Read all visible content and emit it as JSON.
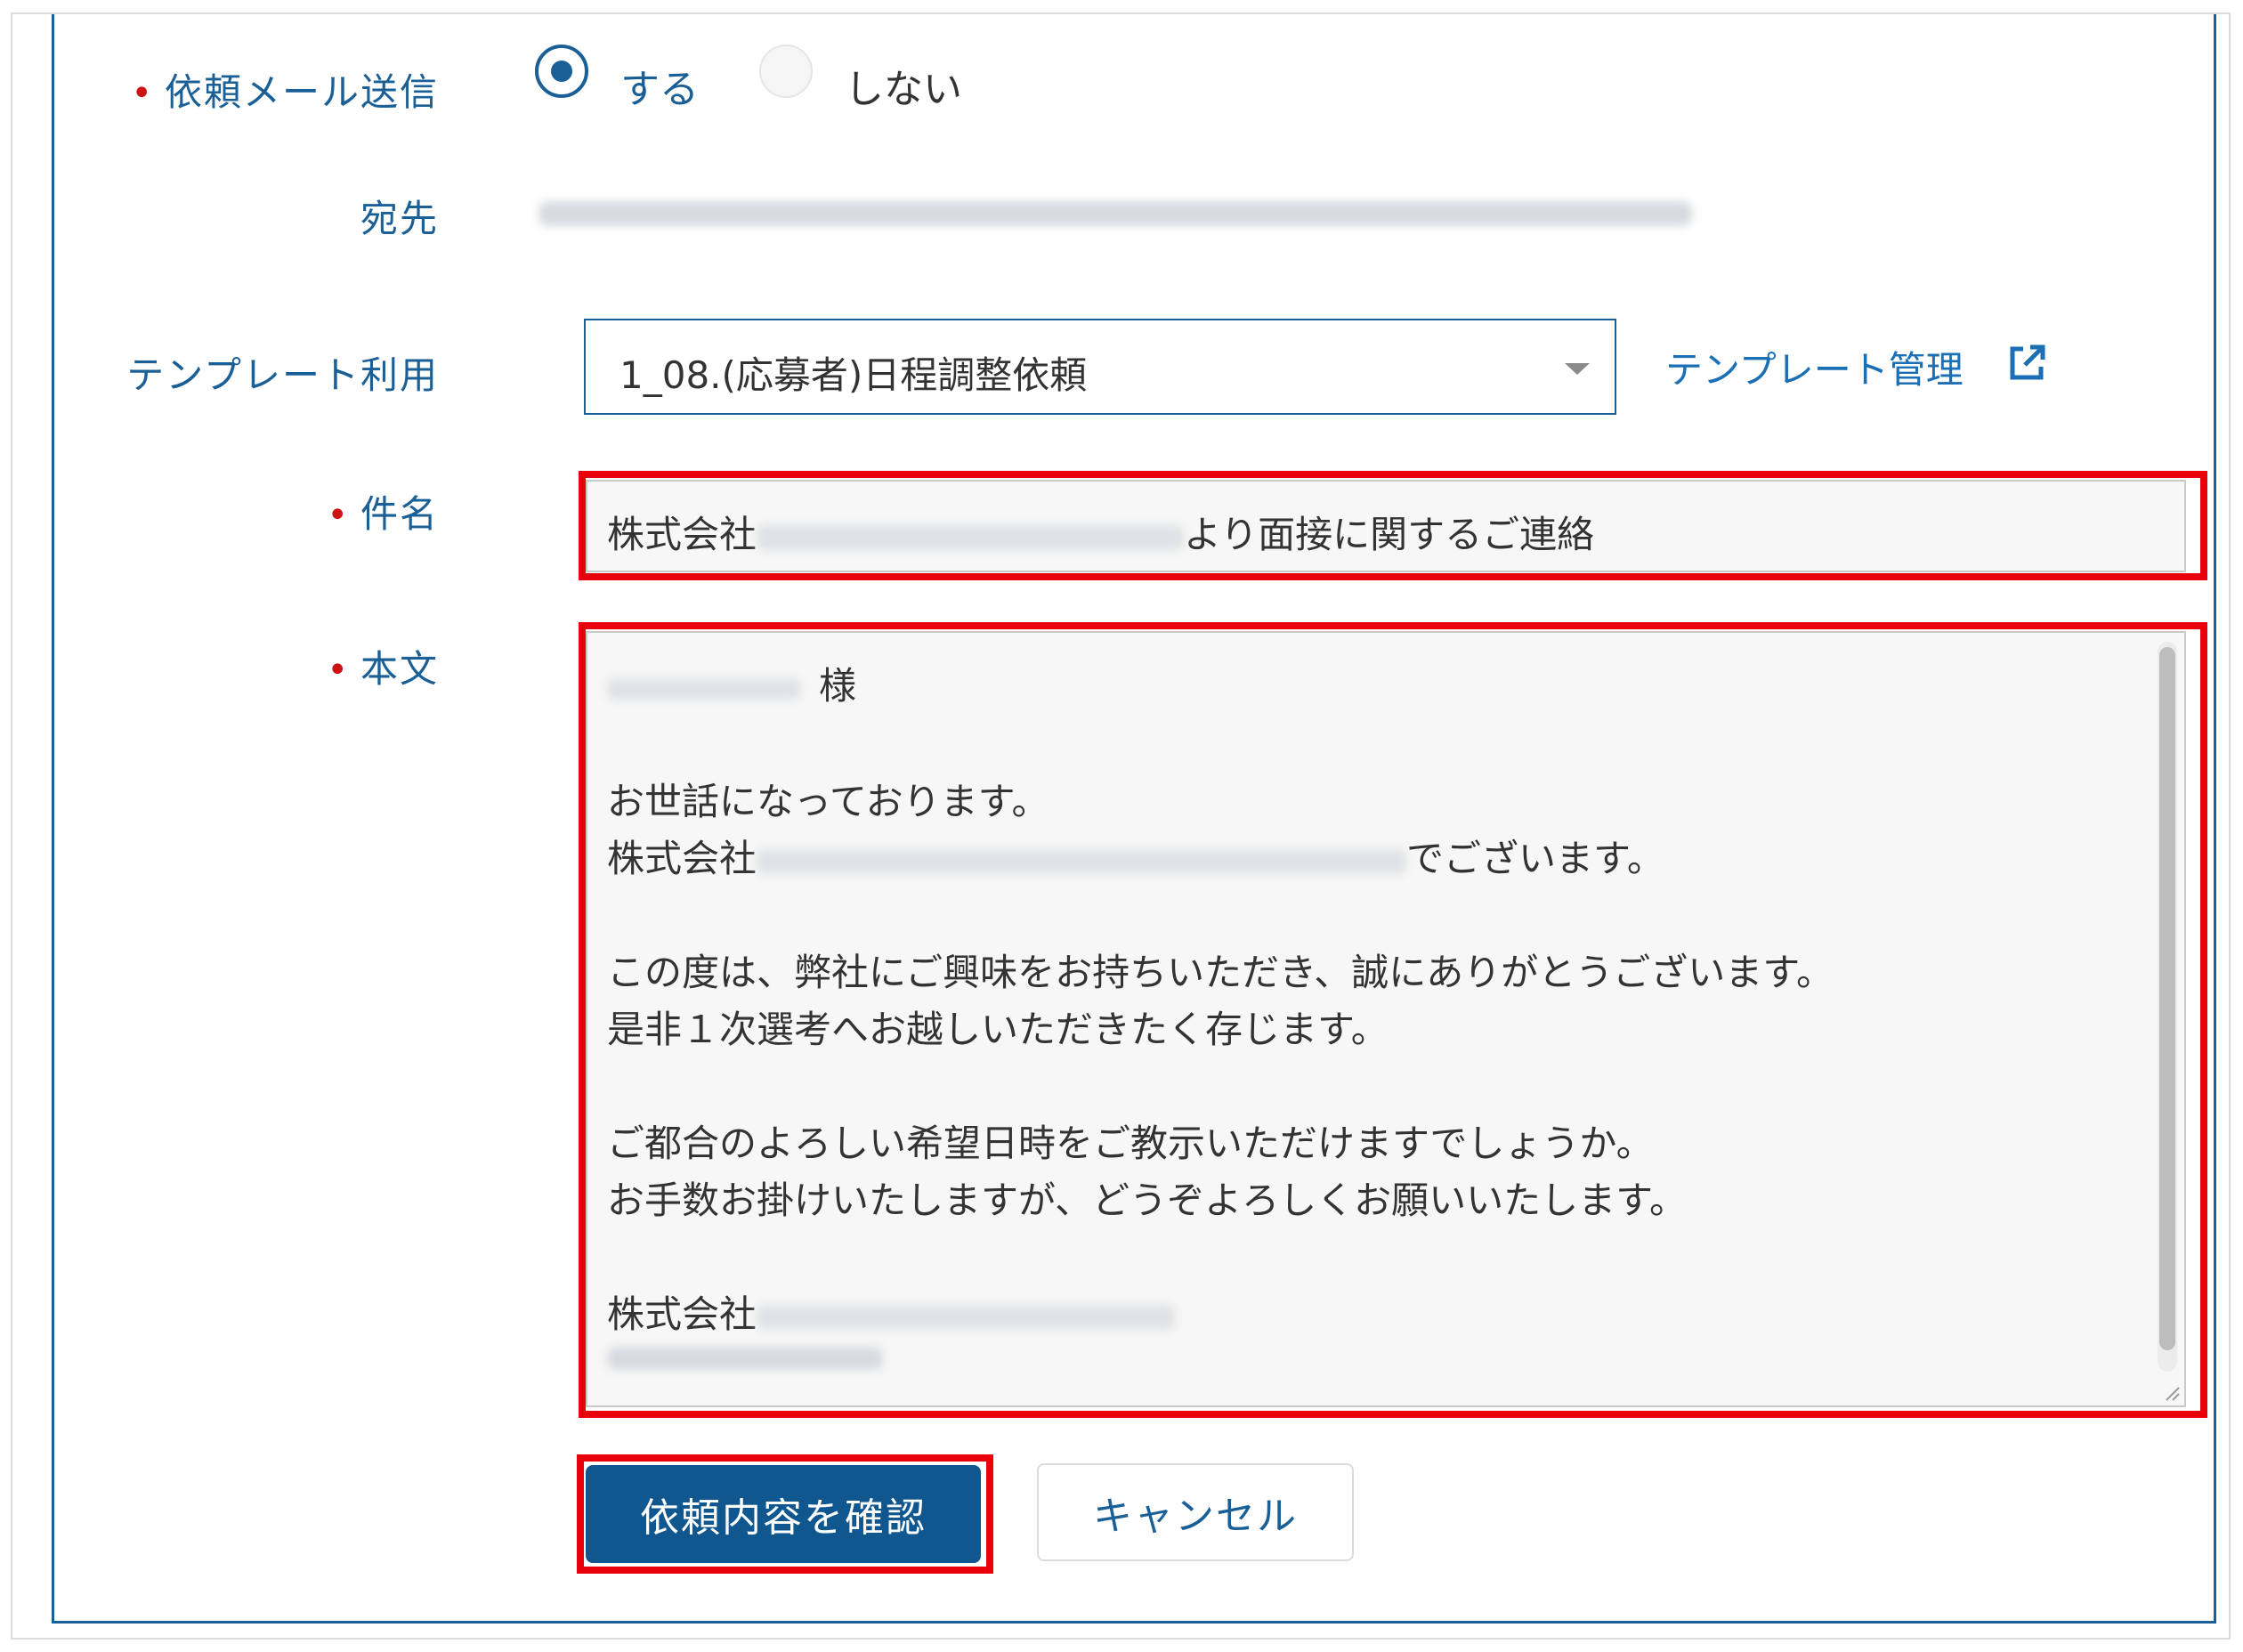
{
  "form": {
    "send_request_mail": {
      "label": "依頼メール送信",
      "option_yes": "する",
      "option_no": "しない",
      "selected": "する"
    },
    "recipient": {
      "label": "宛先"
    },
    "template": {
      "label": "テンプレート利用",
      "selected_value": "1_08.(応募者)日程調整依頼",
      "manage_link": "テンプレート管理"
    },
    "subject": {
      "label": "件名",
      "prefix": "株式会社",
      "suffix": "より面接に関するご連絡"
    },
    "body": {
      "label": "本文",
      "salutation_suffix": "様",
      "greeting": "お世話になっております。",
      "company_prefix": "株式会社",
      "company_suffix": "でございます。",
      "para1_line1": "この度は、弊社にご興味をお持ちいただき、誠にありがとうございます。",
      "para1_line2": "是非１次選考へお越しいただきたく存じます。",
      "para2_line1": "ご都合のよろしい希望日時をご教示いただけますでしょうか。",
      "para2_line2": "お手数お掛けいたしますが、どうぞよろしくお願いいたします。",
      "signature_prefix": "株式会社"
    },
    "buttons": {
      "confirm": "依頼内容を確認",
      "cancel": "キャンセル"
    }
  },
  "colors": {
    "brand": "#1a5f96",
    "primary_button": "#11578f",
    "required_dot": "#cc1212",
    "highlight": "#e8000b",
    "link": "#1a6fb5"
  },
  "icons": [
    "radio-selected",
    "radio-unselected",
    "dropdown-caret-icon",
    "external-link-icon",
    "resize-grip-icon"
  ]
}
